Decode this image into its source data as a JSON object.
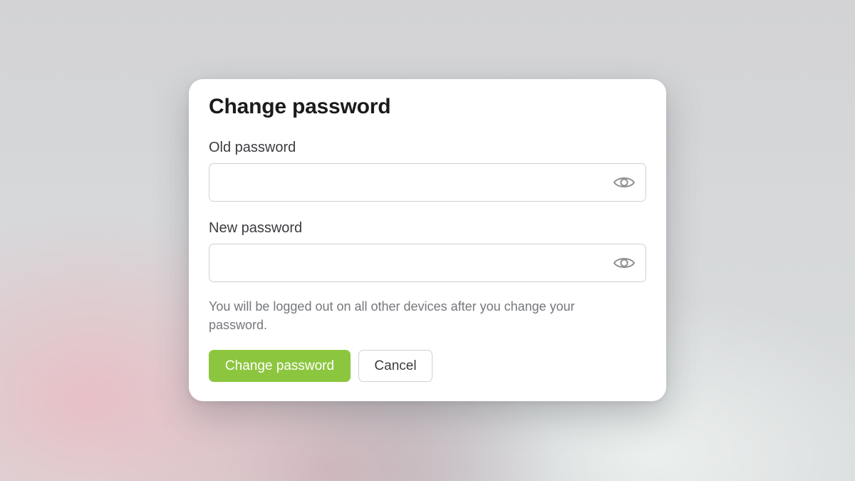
{
  "dialog": {
    "title": "Change password",
    "old_password": {
      "label": "Old password",
      "value": "",
      "toggle_icon": "eye-icon"
    },
    "new_password": {
      "label": "New password",
      "value": "",
      "toggle_icon": "eye-icon"
    },
    "note": "You will be logged out on all other devices after you change your password.",
    "submit_label": "Change password",
    "cancel_label": "Cancel"
  },
  "colors": {
    "primary_button": "#8cc63f",
    "border": "#cfd1d4",
    "muted_text": "#75777b"
  }
}
